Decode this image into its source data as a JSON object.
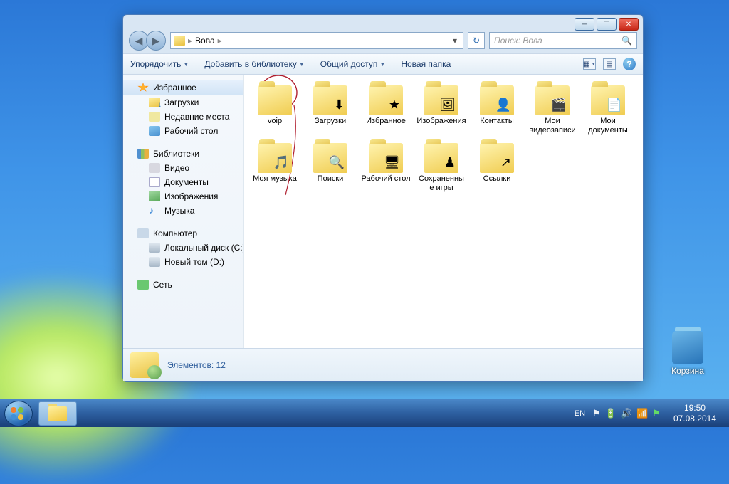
{
  "desktop": {
    "recycle_label": "Корзина"
  },
  "taskbar": {
    "lang": "EN",
    "time": "19:50",
    "date": "07.08.2014"
  },
  "window": {
    "breadcrumb": {
      "root": "Вова"
    },
    "search_placeholder": "Поиск: Вова",
    "toolbar": {
      "organize": "Упорядочить",
      "include": "Добавить в библиотеку",
      "share": "Общий доступ",
      "newfolder": "Новая папка"
    },
    "sidebar": {
      "favorites": {
        "head": "Избранное",
        "items": [
          "Загрузки",
          "Недавние места",
          "Рабочий стол"
        ]
      },
      "libraries": {
        "head": "Библиотеки",
        "items": [
          "Видео",
          "Документы",
          "Изображения",
          "Музыка"
        ]
      },
      "computer": {
        "head": "Компьютер",
        "items": [
          "Локальный диск (C:)",
          "Новый том (D:)"
        ]
      },
      "network": {
        "head": "Сеть"
      }
    },
    "items": [
      {
        "label": "voip",
        "overlay": ""
      },
      {
        "label": "Загрузки",
        "overlay": "⬇"
      },
      {
        "label": "Избранное",
        "overlay": "★"
      },
      {
        "label": "Изображения",
        "overlay": "🖼"
      },
      {
        "label": "Контакты",
        "overlay": "👤"
      },
      {
        "label": "Мои видеозаписи",
        "overlay": "🎬"
      },
      {
        "label": "Мои документы",
        "overlay": "📄"
      },
      {
        "label": "Моя музыка",
        "overlay": "🎵"
      },
      {
        "label": "Поиски",
        "overlay": "🔍"
      },
      {
        "label": "Рабочий стол",
        "overlay": "🖥"
      },
      {
        "label": "Сохраненные игры",
        "overlay": "♟"
      },
      {
        "label": "Ссылки",
        "overlay": "↗"
      }
    ],
    "status": "Элементов: 12"
  }
}
